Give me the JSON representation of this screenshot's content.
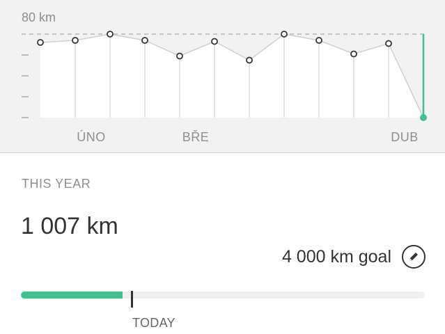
{
  "chart_data": {
    "type": "line",
    "categories": [
      "",
      "ÚNO",
      "",
      "",
      "BŘE",
      "",
      "",
      "",
      "",
      "",
      "DUB"
    ],
    "tick_labels": [
      "ÚNO",
      "BŘE",
      "DUB"
    ],
    "y_top_label": "80 km",
    "ylim": [
      0,
      80
    ],
    "values": [
      72,
      74,
      80,
      74,
      59,
      73,
      55,
      80,
      74,
      61,
      71,
      0
    ],
    "grid": true,
    "colors": {
      "line": "#d0d0d0",
      "fill": "#ffffff",
      "point": "#333333",
      "current": "#3ec28f",
      "dashed": "#b4b4b4"
    }
  },
  "summary": {
    "section_label": "THIS YEAR",
    "total": "1 007 km",
    "goal": "4 000 km goal",
    "edit_icon": "pencil-icon",
    "today_label": "TODAY",
    "progress_fraction": 0.252,
    "progress_color": "#3ec28f"
  }
}
